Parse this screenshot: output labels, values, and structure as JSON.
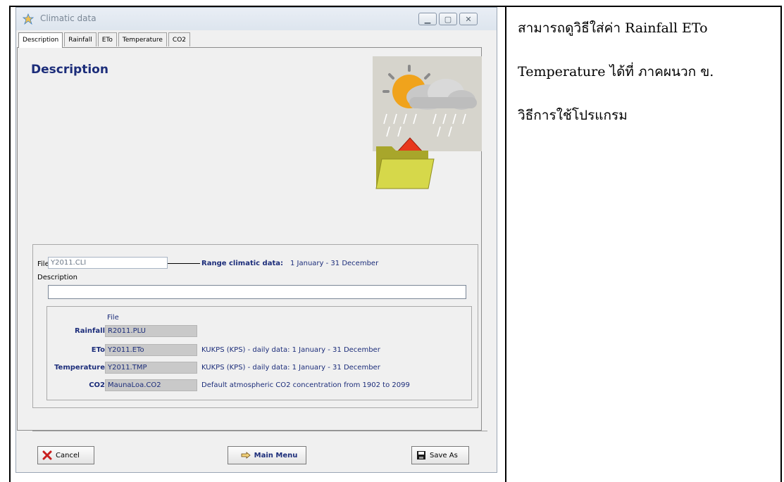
{
  "window": {
    "title": "Climatic data"
  },
  "tabs": [
    {
      "label": "Description",
      "active": true
    },
    {
      "label": "Rainfall",
      "active": false
    },
    {
      "label": "ETo",
      "active": false
    },
    {
      "label": "Temperature",
      "active": false
    },
    {
      "label": "CO2",
      "active": false
    }
  ],
  "heading": "Description",
  "file": {
    "label": "File",
    "value": "Y2011.CLI",
    "range_label": "Range climatic data:",
    "range_value": "1 January - 31 December",
    "description_label": "Description",
    "description_value": ""
  },
  "files": {
    "header": "File",
    "rows": [
      {
        "label": "Rainfall",
        "value": "R2011.PLU",
        "desc": ""
      },
      {
        "label": "ETo",
        "value": "Y2011.ETo",
        "desc": "KUKPS (KPS) - daily data: 1 January - 31 December"
      },
      {
        "label": "Temperature",
        "value": "Y2011.TMP",
        "desc": "KUKPS (KPS) - daily data: 1 January - 31 December"
      },
      {
        "label": "CO2",
        "value": "MaunaLoa.CO2",
        "desc": "Default atmospheric CO2 concentration from 1902 to 2099"
      }
    ]
  },
  "buttons": {
    "cancel": "Cancel",
    "main_menu": "Main Menu",
    "save_as": "Save As"
  },
  "note": {
    "line1": "สามารถดูวิธีใส่ค่า Rainfall ETo",
    "line2": "Temperature ได้ที่ ภาคผนวก ข.",
    "line3": "วิธีการใช้โปรแกรม"
  },
  "colors": {
    "label_blue": "#1c2d7a",
    "field_gray": "#c9c9c9",
    "window_bg": "#f0f0f0"
  }
}
